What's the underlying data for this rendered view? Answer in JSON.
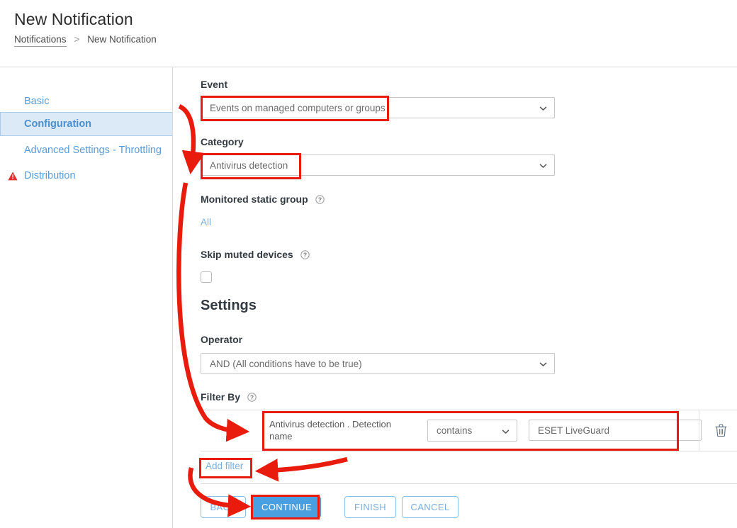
{
  "header": {
    "title": "New Notification",
    "breadcrumb": {
      "root": "Notifications",
      "separator": ">",
      "current": "New Notification"
    }
  },
  "sidebar": {
    "items": [
      {
        "label": "Basic",
        "active": false,
        "icon": ""
      },
      {
        "label": "Configuration",
        "active": true,
        "icon": ""
      },
      {
        "label": "Advanced Settings - Throttling",
        "active": false,
        "icon": ""
      },
      {
        "label": "Distribution",
        "active": false,
        "icon": "warning-triangle-icon"
      }
    ]
  },
  "form": {
    "event": {
      "label": "Event",
      "value": "Events on managed computers or groups"
    },
    "category": {
      "label": "Category",
      "value": "Antivirus detection"
    },
    "monitored_static_group": {
      "label": "Monitored static group",
      "help_icon": "question-circle-icon",
      "value": "All"
    },
    "skip_muted_devices": {
      "label": "Skip muted devices",
      "help_icon": "question-circle-icon",
      "checked": false
    },
    "settings_heading": "Settings",
    "operator": {
      "label": "Operator",
      "value": "AND (All conditions have to be true)"
    },
    "filter_by": {
      "label": "Filter By",
      "help_icon": "question-circle-icon",
      "rows": [
        {
          "name": "Antivirus detection . Detection name",
          "operator": "contains",
          "value": "ESET LiveGuard",
          "delete_icon": "trash-icon"
        }
      ],
      "add_filter_label": "Add filter"
    }
  },
  "footer": {
    "buttons": [
      {
        "label": "BACK",
        "style": "outline"
      },
      {
        "label": "CONTINUE",
        "style": "primary"
      },
      {
        "label": "FINISH",
        "style": "outline"
      },
      {
        "label": "CANCEL",
        "style": "outline"
      }
    ]
  },
  "annotations": {
    "highlight_color": "#e81b0d",
    "arrow_color": "#e81b0d"
  },
  "colors": {
    "accent_blue": "#4a9fe0",
    "link_blue": "#7aaedd",
    "nav_active_bg": "#dceaf7",
    "warning_red": "#e03030",
    "text_dark": "#333a41"
  }
}
